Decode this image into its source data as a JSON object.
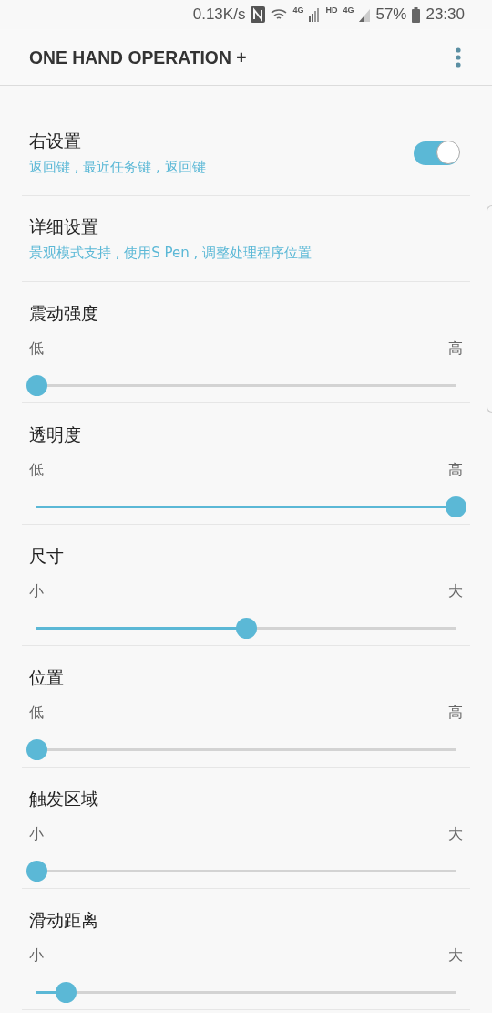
{
  "status_bar": {
    "speed": "0.13K/s",
    "network_1": "4G",
    "hd": "HD",
    "network_2": "4G",
    "battery": "57%",
    "time": "23:30"
  },
  "app_bar": {
    "title": "ONE HAND OPERATION +"
  },
  "settings": [
    {
      "kind": "switch",
      "title": "右设置",
      "summary": "返回键 , 最近任务键 , 返回键",
      "on": true
    },
    {
      "kind": "link",
      "title": "详细设置",
      "summary": "景观模式支持 , 使用S Pen , 调整处理程序位置"
    },
    {
      "kind": "slider",
      "title": "震动强度",
      "min_label": "低",
      "max_label": "高",
      "level": 0
    },
    {
      "kind": "slider",
      "title": "透明度",
      "min_label": "低",
      "max_label": "高",
      "level": 1
    },
    {
      "kind": "slider",
      "title": "尺寸",
      "min_label": "小",
      "max_label": "大",
      "level": 0.5
    },
    {
      "kind": "slider",
      "title": "位置",
      "min_label": "低",
      "max_label": "高",
      "level": 0
    },
    {
      "kind": "slider",
      "title": "触发区域",
      "min_label": "小",
      "max_label": "大",
      "level": 0
    },
    {
      "kind": "slider",
      "title": "滑动距离",
      "min_label": "小",
      "max_label": "大",
      "level": 0.07
    }
  ]
}
